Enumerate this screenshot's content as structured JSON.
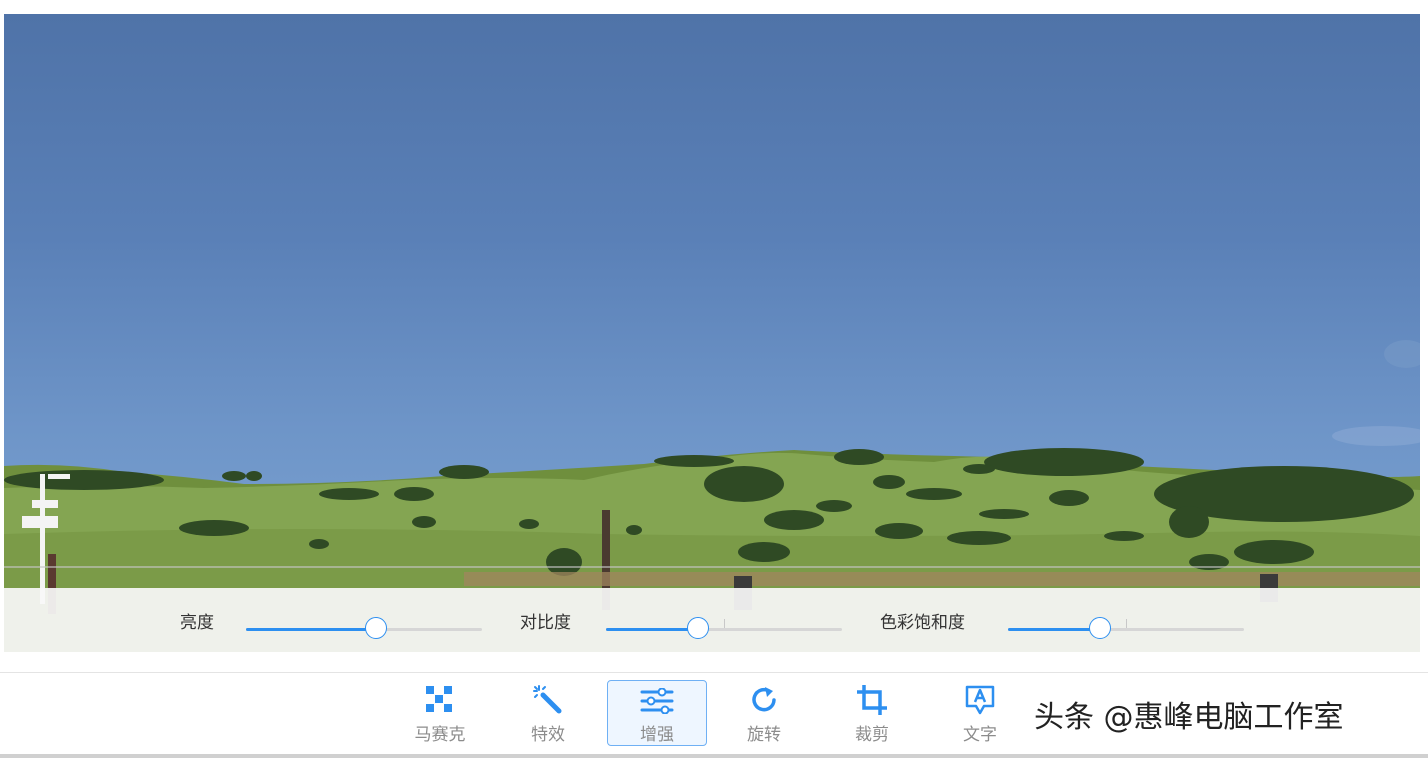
{
  "adjustments": {
    "brightness": {
      "label": "亮度",
      "value": 0.55
    },
    "contrast": {
      "label": "对比度",
      "value": 0.39
    },
    "saturation": {
      "label": "色彩饱和度",
      "value": 0.39
    }
  },
  "toolbar": {
    "mosaic": "马赛克",
    "effects": "特效",
    "enhance": "增强",
    "rotate": "旋转",
    "crop": "裁剪",
    "text": "文字",
    "active": "enhance"
  },
  "watermark": "头条 @惠峰电脑工作室",
  "colors": {
    "accent": "#2d8ff0",
    "sky": "#5a80b7",
    "grass": "#7a9a4a"
  }
}
